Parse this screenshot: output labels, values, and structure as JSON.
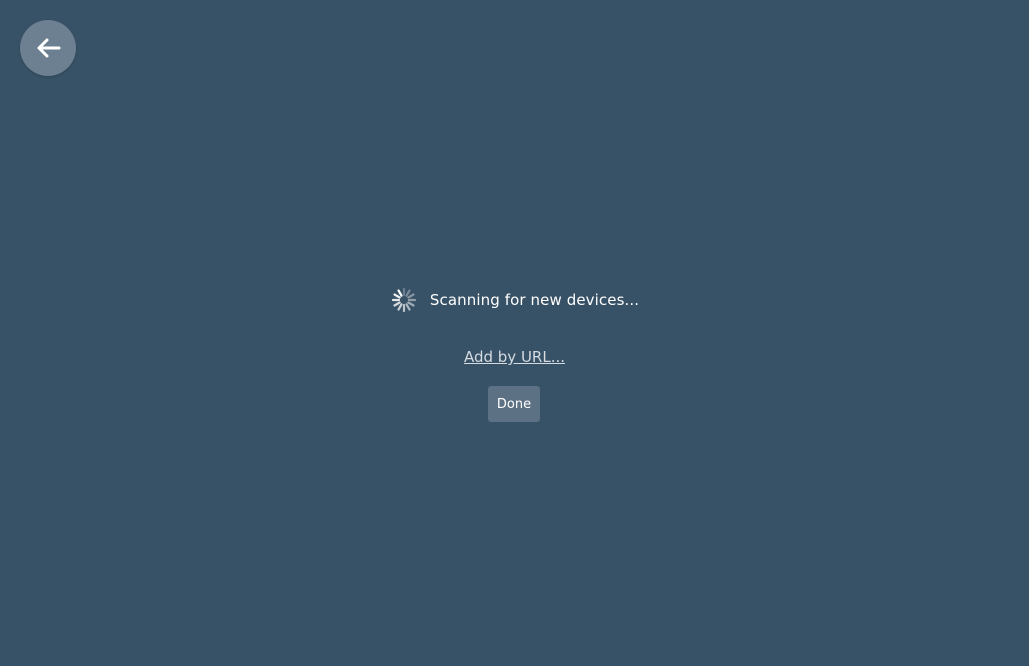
{
  "back_button": {
    "icon": "arrow-left-icon"
  },
  "scanning": {
    "icon": "loading-spinner-icon",
    "text": "Scanning for new devices..."
  },
  "add_by_url": {
    "label": "Add by URL..."
  },
  "done_button": {
    "label": "Done"
  },
  "colors": {
    "background": "#375166",
    "back_button_bg": "#6c8091",
    "done_button_bg": "#5c7183",
    "link": "#d4dbe1",
    "text": "#ffffff"
  }
}
